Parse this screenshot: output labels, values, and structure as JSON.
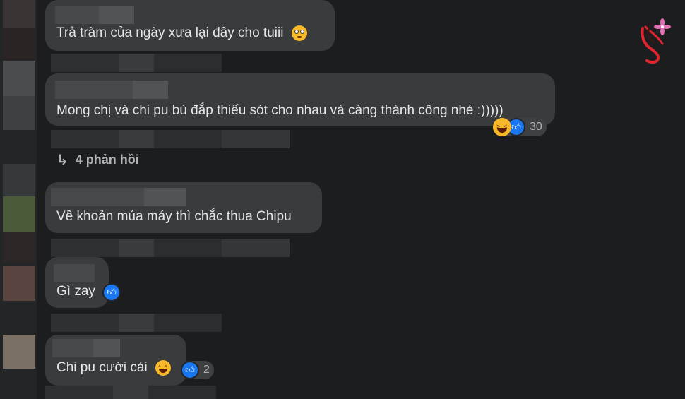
{
  "comments": [
    {
      "text": "Trả tràm của ngày xưa lại đây cho tuiii",
      "emoji": "flushed-face"
    },
    {
      "text": "Mong chị và chi pu bù đắp thiếu sót cho nhau và càng thành công nhé :)))))",
      "reaction_count": "30"
    },
    {
      "text": "Về khoản múa máy thì chắc thua Chipu"
    },
    {
      "text": "Gì zay"
    },
    {
      "text": "Chi pu cười cái",
      "reaction_count": "2"
    }
  ],
  "replies_link": "4 phản hồi",
  "icons": {
    "like": "thumbs-up-icon",
    "laugh": "laughing-face-icon",
    "reply_arrow": "reply-arrow-icon",
    "logo": "site-logo"
  },
  "colors": {
    "background": "#1c1d1f",
    "bubble": "#3a3b3c",
    "text": "#e4e6eb",
    "secondary": "#b0b3b8",
    "like_blue": "#1877f2",
    "logo_red": "#e0252e",
    "logo_pink": "#e86fb5"
  }
}
